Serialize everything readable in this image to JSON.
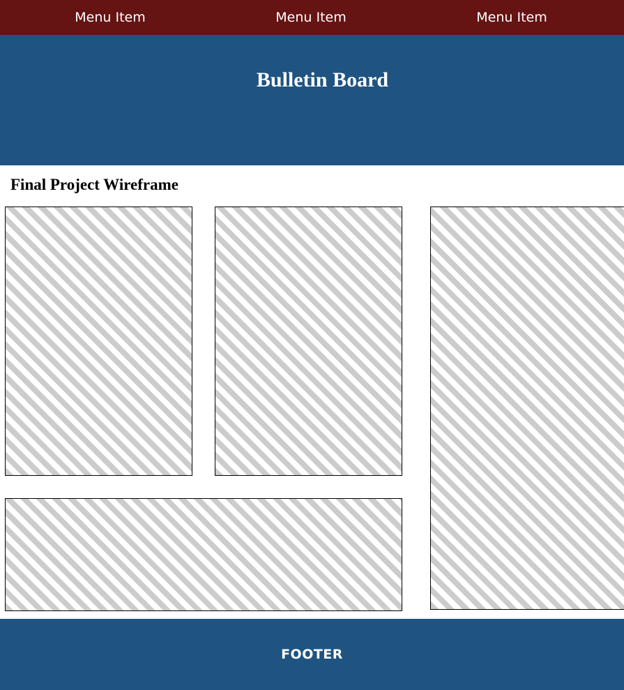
{
  "colors": {
    "nav_bg": "#651313",
    "brand_bg": "#1f5381",
    "stripe": "#cccccc",
    "text_light": "#ffffff"
  },
  "nav": {
    "items": [
      {
        "label": "Menu Item"
      },
      {
        "label": "Menu Item"
      },
      {
        "label": "Menu Item"
      }
    ]
  },
  "header": {
    "title": "Bulletin Board"
  },
  "main": {
    "heading": "Final Project Wireframe"
  },
  "footer": {
    "label": "FOOTER"
  }
}
